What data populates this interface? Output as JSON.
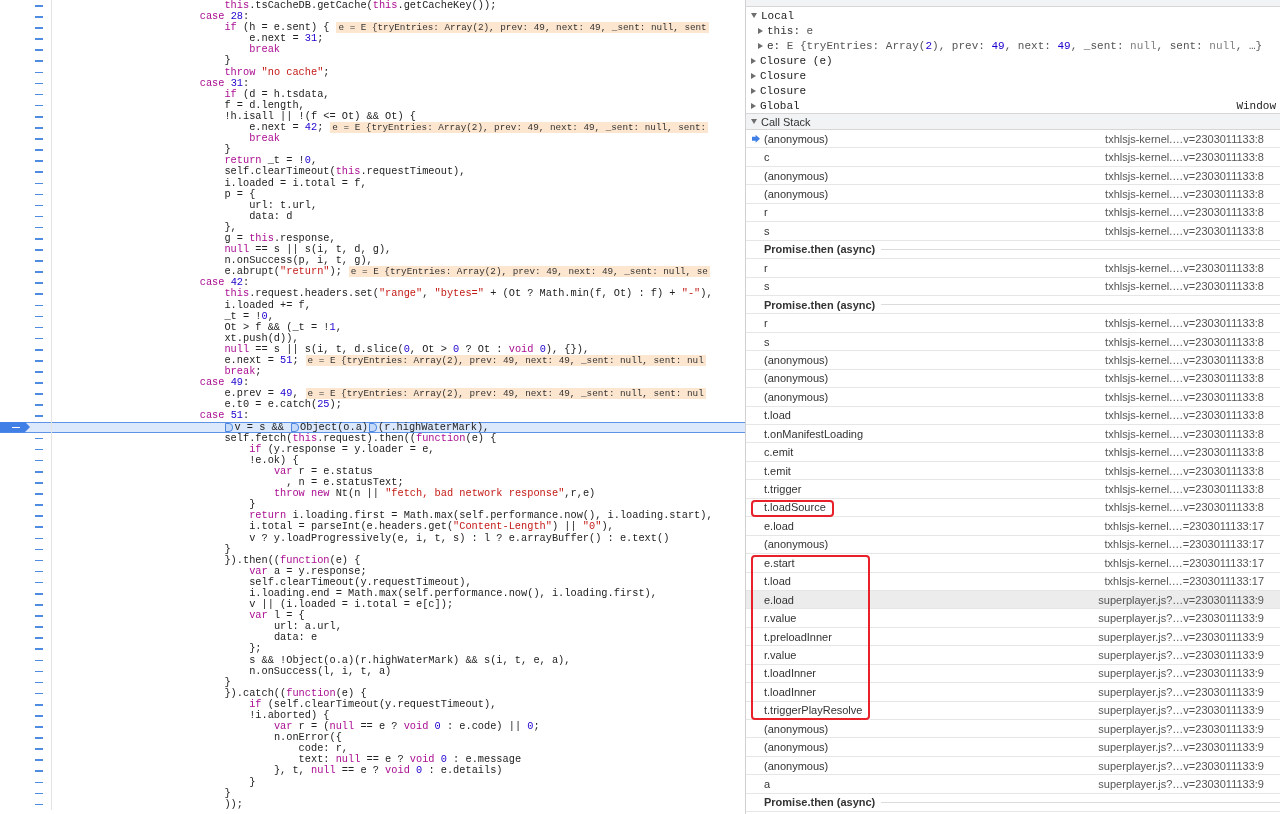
{
  "source": {
    "lines": [
      {
        "text": "        this.tsCacheDB.getCache(this.getCacheKey());",
        "paused": false
      },
      {
        "text": "    case 28:",
        "paused": false
      },
      {
        "text": "        if (h = e.sent) {",
        "inline_value": "e = E {tryEntries: Array(2), prev: 49, next: 49, _sent: null, sent",
        "paused": false
      },
      {
        "text": "            e.next = 31;",
        "paused": false
      },
      {
        "text": "            break",
        "paused": false
      },
      {
        "text": "        }",
        "paused": false
      },
      {
        "text": "        throw \"no cache\";",
        "paused": false
      },
      {
        "text": "    case 31:",
        "paused": false
      },
      {
        "text": "        if (d = h.tsdata,",
        "paused": false
      },
      {
        "text": "        f = d.length,",
        "paused": false
      },
      {
        "text": "        !h.isall || !(f <= Ot) && Ot) {",
        "paused": false
      },
      {
        "text": "            e.next = 42;",
        "inline_value": "e = E {tryEntries: Array(2), prev: 49, next: 49, _sent: null, sent:",
        "paused": false
      },
      {
        "text": "            break",
        "paused": false
      },
      {
        "text": "        }",
        "paused": false
      },
      {
        "text": "        return _t = !0,",
        "paused": false
      },
      {
        "text": "        self.clearTimeout(this.requestTimeout),",
        "paused": false
      },
      {
        "text": "        i.loaded = i.total = f,",
        "paused": false
      },
      {
        "text": "        p = {",
        "paused": false
      },
      {
        "text": "            url: t.url,",
        "paused": false
      },
      {
        "text": "            data: d",
        "paused": false
      },
      {
        "text": "        },",
        "paused": false
      },
      {
        "text": "        g = this.response,",
        "paused": false
      },
      {
        "text": "        null == s || s(i, t, d, g),",
        "paused": false
      },
      {
        "text": "        n.onSuccess(p, i, t, g),",
        "paused": false
      },
      {
        "text": "        e.abrupt(\"return\");",
        "inline_value": "e = E {tryEntries: Array(2), prev: 49, next: 49, _sent: null, se",
        "paused": false
      },
      {
        "text": "    case 42:",
        "paused": false
      },
      {
        "text": "        this.request.headers.set(\"range\", \"bytes=\" + (Ot ? Math.min(f, Ot) : f) + \"-\"),",
        "paused": false
      },
      {
        "text": "        i.loaded += f,",
        "paused": false
      },
      {
        "text": "        _t = !0,",
        "paused": false
      },
      {
        "text": "        Ot > f && (_t = !1,",
        "paused": false
      },
      {
        "text": "        xt.push(d)),",
        "paused": false
      },
      {
        "text": "        null == s || s(i, t, d.slice(0, Ot > 0 ? Ot : void 0), {}),",
        "paused": false
      },
      {
        "text": "        e.next = 51;",
        "inline_value": "e = E {tryEntries: Array(2), prev: 49, next: 49, _sent: null, sent: nul",
        "paused": false
      },
      {
        "text": "        break;",
        "paused": false
      },
      {
        "text": "    case 49:",
        "paused": false
      },
      {
        "text": "        e.prev = 49,",
        "inline_value": "e = E {tryEntries: Array(2), prev: 49, next: 49, _sent: null, sent: nul",
        "paused": false
      },
      {
        "text": "        e.t0 = e.catch(25);",
        "paused": false
      },
      {
        "text": "    case 51:",
        "paused": false
      },
      {
        "segments": [
          "        v = s && ",
          "Object(o.a)",
          "(r.highWaterMark),"
        ],
        "paused": true
      },
      {
        "text": "        self.fetch(this.request).then((function(e) {",
        "paused": false
      },
      {
        "text": "            if (y.response = y.loader = e,",
        "paused": false
      },
      {
        "text": "            !e.ok) {",
        "paused": false
      },
      {
        "text": "                var r = e.status",
        "paused": false
      },
      {
        "text": "                  , n = e.statusText;",
        "paused": false
      },
      {
        "text": "                throw new Nt(n || \"fetch, bad network response\",r,e)",
        "paused": false
      },
      {
        "text": "            }",
        "paused": false
      },
      {
        "text": "            return i.loading.first = Math.max(self.performance.now(), i.loading.start),",
        "paused": false
      },
      {
        "text": "            i.total = parseInt(e.headers.get(\"Content-Length\") || \"0\"),",
        "paused": false
      },
      {
        "text": "            v ? y.loadProgressively(e, i, t, s) : l ? e.arrayBuffer() : e.text()",
        "paused": false
      },
      {
        "text": "        }",
        "paused": false
      },
      {
        "text": "        }).then((function(e) {",
        "paused": false
      },
      {
        "text": "            var a = y.response;",
        "paused": false
      },
      {
        "text": "            self.clearTimeout(y.requestTimeout),",
        "paused": false
      },
      {
        "text": "            i.loading.end = Math.max(self.performance.now(), i.loading.first),",
        "paused": false
      },
      {
        "text": "            v || (i.loaded = i.total = e[c]);",
        "paused": false
      },
      {
        "text": "            var l = {",
        "paused": false
      },
      {
        "text": "                url: a.url,",
        "paused": false
      },
      {
        "text": "                data: e",
        "paused": false
      },
      {
        "text": "            };",
        "paused": false
      },
      {
        "text": "            s && !Object(o.a)(r.highWaterMark) && s(i, t, e, a),",
        "paused": false
      },
      {
        "text": "            n.onSuccess(l, i, t, a)",
        "paused": false
      },
      {
        "text": "        }",
        "paused": false
      },
      {
        "text": "        }).catch((function(e) {",
        "paused": false
      },
      {
        "text": "            if (self.clearTimeout(y.requestTimeout),",
        "paused": false
      },
      {
        "text": "            !i.aborted) {",
        "paused": false
      },
      {
        "text": "                var r = (null == e ? void 0 : e.code) || 0;",
        "paused": false
      },
      {
        "text": "                n.onError({",
        "paused": false
      },
      {
        "text": "                    code: r,",
        "paused": false
      },
      {
        "text": "                    text: null == e ? void 0 : e.message",
        "paused": false
      },
      {
        "text": "                }, t, null == e ? void 0 : e.details)",
        "paused": false
      },
      {
        "text": "            }",
        "paused": false
      },
      {
        "text": "        }",
        "paused": false
      },
      {
        "text": "        ));",
        "paused": false
      }
    ]
  },
  "scope": {
    "items": [
      {
        "kind": "scope",
        "label": "Local",
        "expanded": true,
        "children": [
          {
            "kind": "property",
            "name": "this:",
            "value": "e",
            "expanded": false
          },
          {
            "kind": "property",
            "name": "e:",
            "value": "E {tryEntries: Array(2), prev: 49, next: 49, _sent: null, sent: null, …}",
            "expanded": false
          }
        ]
      },
      {
        "kind": "scope",
        "label": "Closure (e)",
        "expanded": false
      },
      {
        "kind": "scope",
        "label": "Closure",
        "expanded": false
      },
      {
        "kind": "scope",
        "label": "Closure",
        "expanded": false
      },
      {
        "kind": "scope",
        "label": "Global",
        "value": "Window",
        "expanded": false
      }
    ]
  },
  "call_stack": {
    "title": "Call Stack",
    "expanded": true,
    "frames": [
      {
        "kind": "frame",
        "name": "(anonymous)",
        "location": "txhlsjs-kernel.…v=2303011133:8",
        "current": true,
        "selected": false,
        "annotated": false
      },
      {
        "kind": "frame",
        "name": "c",
        "location": "txhlsjs-kernel.…v=2303011133:8",
        "current": false,
        "selected": false,
        "annotated": false
      },
      {
        "kind": "frame",
        "name": "(anonymous)",
        "location": "txhlsjs-kernel.…v=2303011133:8",
        "current": false,
        "selected": false,
        "annotated": false
      },
      {
        "kind": "frame",
        "name": "(anonymous)",
        "location": "txhlsjs-kernel.…v=2303011133:8",
        "current": false,
        "selected": false,
        "annotated": false
      },
      {
        "kind": "frame",
        "name": "r",
        "location": "txhlsjs-kernel.…v=2303011133:8",
        "current": false,
        "selected": false,
        "annotated": false
      },
      {
        "kind": "frame",
        "name": "s",
        "location": "txhlsjs-kernel.…v=2303011133:8",
        "current": false,
        "selected": false,
        "annotated": false
      },
      {
        "kind": "async",
        "label": "Promise.then (async)"
      },
      {
        "kind": "frame",
        "name": "r",
        "location": "txhlsjs-kernel.…v=2303011133:8",
        "current": false,
        "selected": false,
        "annotated": false
      },
      {
        "kind": "frame",
        "name": "s",
        "location": "txhlsjs-kernel.…v=2303011133:8",
        "current": false,
        "selected": false,
        "annotated": false
      },
      {
        "kind": "async",
        "label": "Promise.then (async)"
      },
      {
        "kind": "frame",
        "name": "r",
        "location": "txhlsjs-kernel.…v=2303011133:8",
        "current": false,
        "selected": false,
        "annotated": false
      },
      {
        "kind": "frame",
        "name": "s",
        "location": "txhlsjs-kernel.…v=2303011133:8",
        "current": false,
        "selected": false,
        "annotated": false
      },
      {
        "kind": "frame",
        "name": "(anonymous)",
        "location": "txhlsjs-kernel.…v=2303011133:8",
        "current": false,
        "selected": false,
        "annotated": false
      },
      {
        "kind": "frame",
        "name": "(anonymous)",
        "location": "txhlsjs-kernel.…v=2303011133:8",
        "current": false,
        "selected": false,
        "annotated": false
      },
      {
        "kind": "frame",
        "name": "(anonymous)",
        "location": "txhlsjs-kernel.…v=2303011133:8",
        "current": false,
        "selected": false,
        "annotated": false
      },
      {
        "kind": "frame",
        "name": "t.load",
        "location": "txhlsjs-kernel.…v=2303011133:8",
        "current": false,
        "selected": false,
        "annotated": false
      },
      {
        "kind": "frame",
        "name": "t.onManifestLoading",
        "location": "txhlsjs-kernel.…v=2303011133:8",
        "current": false,
        "selected": false,
        "annotated": false
      },
      {
        "kind": "frame",
        "name": "c.emit",
        "location": "txhlsjs-kernel.…v=2303011133:8",
        "current": false,
        "selected": false,
        "annotated": false
      },
      {
        "kind": "frame",
        "name": "t.emit",
        "location": "txhlsjs-kernel.…v=2303011133:8",
        "current": false,
        "selected": false,
        "annotated": false
      },
      {
        "kind": "frame",
        "name": "t.trigger",
        "location": "txhlsjs-kernel.…v=2303011133:8",
        "current": false,
        "selected": false,
        "annotated": false
      },
      {
        "kind": "highlight",
        "frames": [
          {
            "kind": "frame",
            "name": "t.loadSource",
            "location": "txhlsjs-kernel.…v=2303011133:8",
            "current": false,
            "selected": false
          }
        ]
      },
      {
        "kind": "frame",
        "name": "e.load",
        "location": "txhlsjs-kernel.…=2303011133:17",
        "current": false,
        "selected": false,
        "annotated": false
      },
      {
        "kind": "frame",
        "name": "(anonymous)",
        "location": "txhlsjs-kernel.…=2303011133:17",
        "current": false,
        "selected": false,
        "annotated": false
      },
      {
        "kind": "highlight",
        "frames": [
          {
            "kind": "frame",
            "name": "e.start",
            "location": "txhlsjs-kernel.…=2303011133:17",
            "current": false,
            "selected": false
          },
          {
            "kind": "frame",
            "name": "t.load",
            "location": "txhlsjs-kernel.…=2303011133:17",
            "current": false,
            "selected": false
          },
          {
            "kind": "frame",
            "name": "e.load",
            "location": "superplayer.js?…v=2303011133:9",
            "current": false,
            "selected": true
          },
          {
            "kind": "frame",
            "name": "r.value",
            "location": "superplayer.js?…v=2303011133:9",
            "current": false,
            "selected": false
          },
          {
            "kind": "frame",
            "name": "t.preloadInner",
            "location": "superplayer.js?…v=2303011133:9",
            "current": false,
            "selected": false
          },
          {
            "kind": "frame",
            "name": "r.value",
            "location": "superplayer.js?…v=2303011133:9",
            "current": false,
            "selected": false
          },
          {
            "kind": "frame",
            "name": "t.loadInner",
            "location": "superplayer.js?…v=2303011133:9",
            "current": false,
            "selected": false
          },
          {
            "kind": "frame",
            "name": "t.loadInner",
            "location": "superplayer.js?…v=2303011133:9",
            "current": false,
            "selected": false
          },
          {
            "kind": "frame",
            "name": "t.triggerPlayResolve",
            "location": "superplayer.js?…v=2303011133:9",
            "current": false,
            "selected": false
          }
        ]
      },
      {
        "kind": "frame",
        "name": "(anonymous)",
        "location": "superplayer.js?…v=2303011133:9",
        "current": false,
        "selected": false,
        "annotated": false
      },
      {
        "kind": "frame",
        "name": "(anonymous)",
        "location": "superplayer.js?…v=2303011133:9",
        "current": false,
        "selected": false,
        "annotated": false
      },
      {
        "kind": "frame",
        "name": "(anonymous)",
        "location": "superplayer.js?…v=2303011133:9",
        "current": false,
        "selected": false,
        "annotated": false
      },
      {
        "kind": "frame",
        "name": "a",
        "location": "superplayer.js?…v=2303011133:9",
        "current": false,
        "selected": false,
        "annotated": false
      },
      {
        "kind": "async",
        "label": "Promise.then (async)"
      }
    ]
  }
}
